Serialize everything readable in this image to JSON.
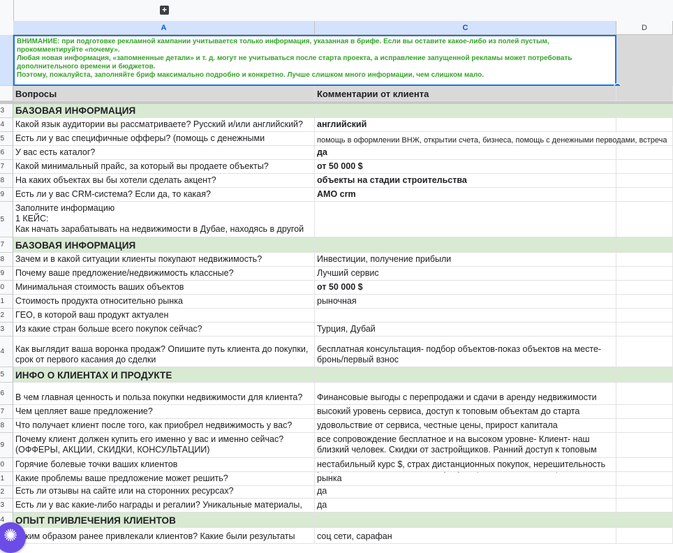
{
  "columns": {
    "A": "A",
    "C": "C",
    "D": "D"
  },
  "notice": {
    "lines": [
      "ВНИМАНИЕ: при подготовке рекламной кампании учитывается только информация, указанная в брифе. Если вы оставите какое-либо из полей пустым, прокомментируйте «почему».",
      "Любая новая информация, «запомненные детали» и т. д. могут не учитываться после старта проекта, а исправление запущенной рекламы может потребовать дополнительного времени и бюджетов.",
      "Поэтому, пожалуйста, заполняйте бриф максимально подробно и конкретно. Лучше слишком много информации, чем слишком мало."
    ]
  },
  "header": {
    "questions": "Вопросы",
    "comments": "Комментарии от клиента"
  },
  "rows": [
    {
      "rn": "3",
      "a": "БАЗОВАЯ ИНФОРМАЦИЯ",
      "c": ""
    },
    {
      "rn": "4",
      "a": "Какой язык аудитории вы рассматриваете? Русский и/или английский?",
      "c": "английский"
    },
    {
      "rn": "5",
      "a": "Есть ли у вас специфичные офферы? (помощь с денежными",
      "c": "помощь в оформлении ВНЖ, открытии счета, бизнеса, помощь с денежными перводами, встреча"
    },
    {
      "rn": "6",
      "a": "У вас есть каталог?",
      "c": "да"
    },
    {
      "rn": "7",
      "a": "Какой минимальный прайс, за который вы продаете объекты?",
      "c": "от 50 000 $"
    },
    {
      "rn": "8",
      "a": "На каких объектах вы бы хотели сделать акцент?",
      "c": "объекты на стадии строительства"
    },
    {
      "rn": "9",
      "a": "Есть ли у вас CRM-система? Если да, то какая?",
      "c": "AMO crm"
    },
    {
      "rn": "5",
      "a": "Заполните информацию\n1 КЕЙС:\nКак начать зарабатывать на недвижимости в Дубае, находясь в другой",
      "c": ""
    },
    {
      "rn": "7",
      "a": "БАЗОВАЯ ИНФОРМАЦИЯ",
      "c": ""
    },
    {
      "rn": "8",
      "a": "Зачем и в какой ситуации клиенты покупают недвижимость?",
      "c": "Инвестиции, получение прибыли"
    },
    {
      "rn": "9",
      "a": "Почему ваше предложение/недвижимость классные?",
      "c": "Лучший сервис"
    },
    {
      "rn": "0",
      "a": "Минимальная стоимость ваших объектов",
      "c": "от 50 000 $"
    },
    {
      "rn": "1",
      "a": "Стоимость продукта относительно рынка",
      "c": "рыночная"
    },
    {
      "rn": "2",
      "a": "ГЕО, в которой ваш продукт актуален",
      "c": ""
    },
    {
      "rn": "3",
      "a": "Из какие стран больше всего покупок сейчас?",
      "c": "Турция, Дубай"
    },
    {
      "rn": "4",
      "a": "Как выглядит ваша воронка продаж? Опишите путь клиента до покупки,\nсрок от первого касания до сделки",
      "c": "бесплатная консультация- подбор объектов-показ объектов на месте-\nбронь/первый взнос"
    },
    {
      "rn": "5",
      "a": "ИНФО О КЛИЕНТАХ И ПРОДУКТЕ",
      "c": ""
    },
    {
      "rn": "6",
      "a": "В чем главная ценность и польза покупки недвижимости для клиента?",
      "c": "Финансовые выгоды с перепродажи и сдачи в аренду недвижимости"
    },
    {
      "rn": "7",
      "a": "Чем цепляет ваше предложение?",
      "c": "высокий уровень сервиса, доступ к топовым объектам до старта"
    },
    {
      "rn": "8",
      "a": "Что получает клиент после того, как приобрел недвижимость у вас?",
      "c": "удовольствие от сервиса, честные цены, прирост капитала"
    },
    {
      "rn": "9",
      "a": "Почему клиент должен купить его именно у вас и именно сейчас?\n(ОФФЕРЫ, АКЦИИ, СКИДКИ, КОНСУЛЬТАЦИИ)",
      "c": "все сопровождение бесплатное и на высоком уровне- Клиент- наш\nблизкий человек. Скидки от застройщиков. Ранний доступ к топовым"
    },
    {
      "rn": "0",
      "a": "Горячие болевые точки ваших клиентов",
      "c": "нестабильный курс $, страх дистанционных покупок, нерешительность"
    },
    {
      "rn": "1",
      "a": "Какие проблемы ваше предложение может решить?",
      "c": "уверенность в качестве наших услуг, гарантия высокого сервиса. анализ рынка"
    },
    {
      "rn": "2",
      "a": "Есть ли отзывы на сайте или на сторонних ресурсах?",
      "c": "да"
    },
    {
      "rn": "3",
      "a": "Есть ли у вас какие-либо награды и регалии? Уникальные материалы,",
      "c": "да"
    },
    {
      "rn": "4",
      "a": "ОПЫТ ПРИВЛЕЧЕНИЯ КЛИЕНТОВ",
      "c": ""
    },
    {
      "rn": "5",
      "a": "Каким образом ранее привлекали клиентов? Какие были результаты",
      "c": "соц сети, сарафан"
    }
  ]
}
